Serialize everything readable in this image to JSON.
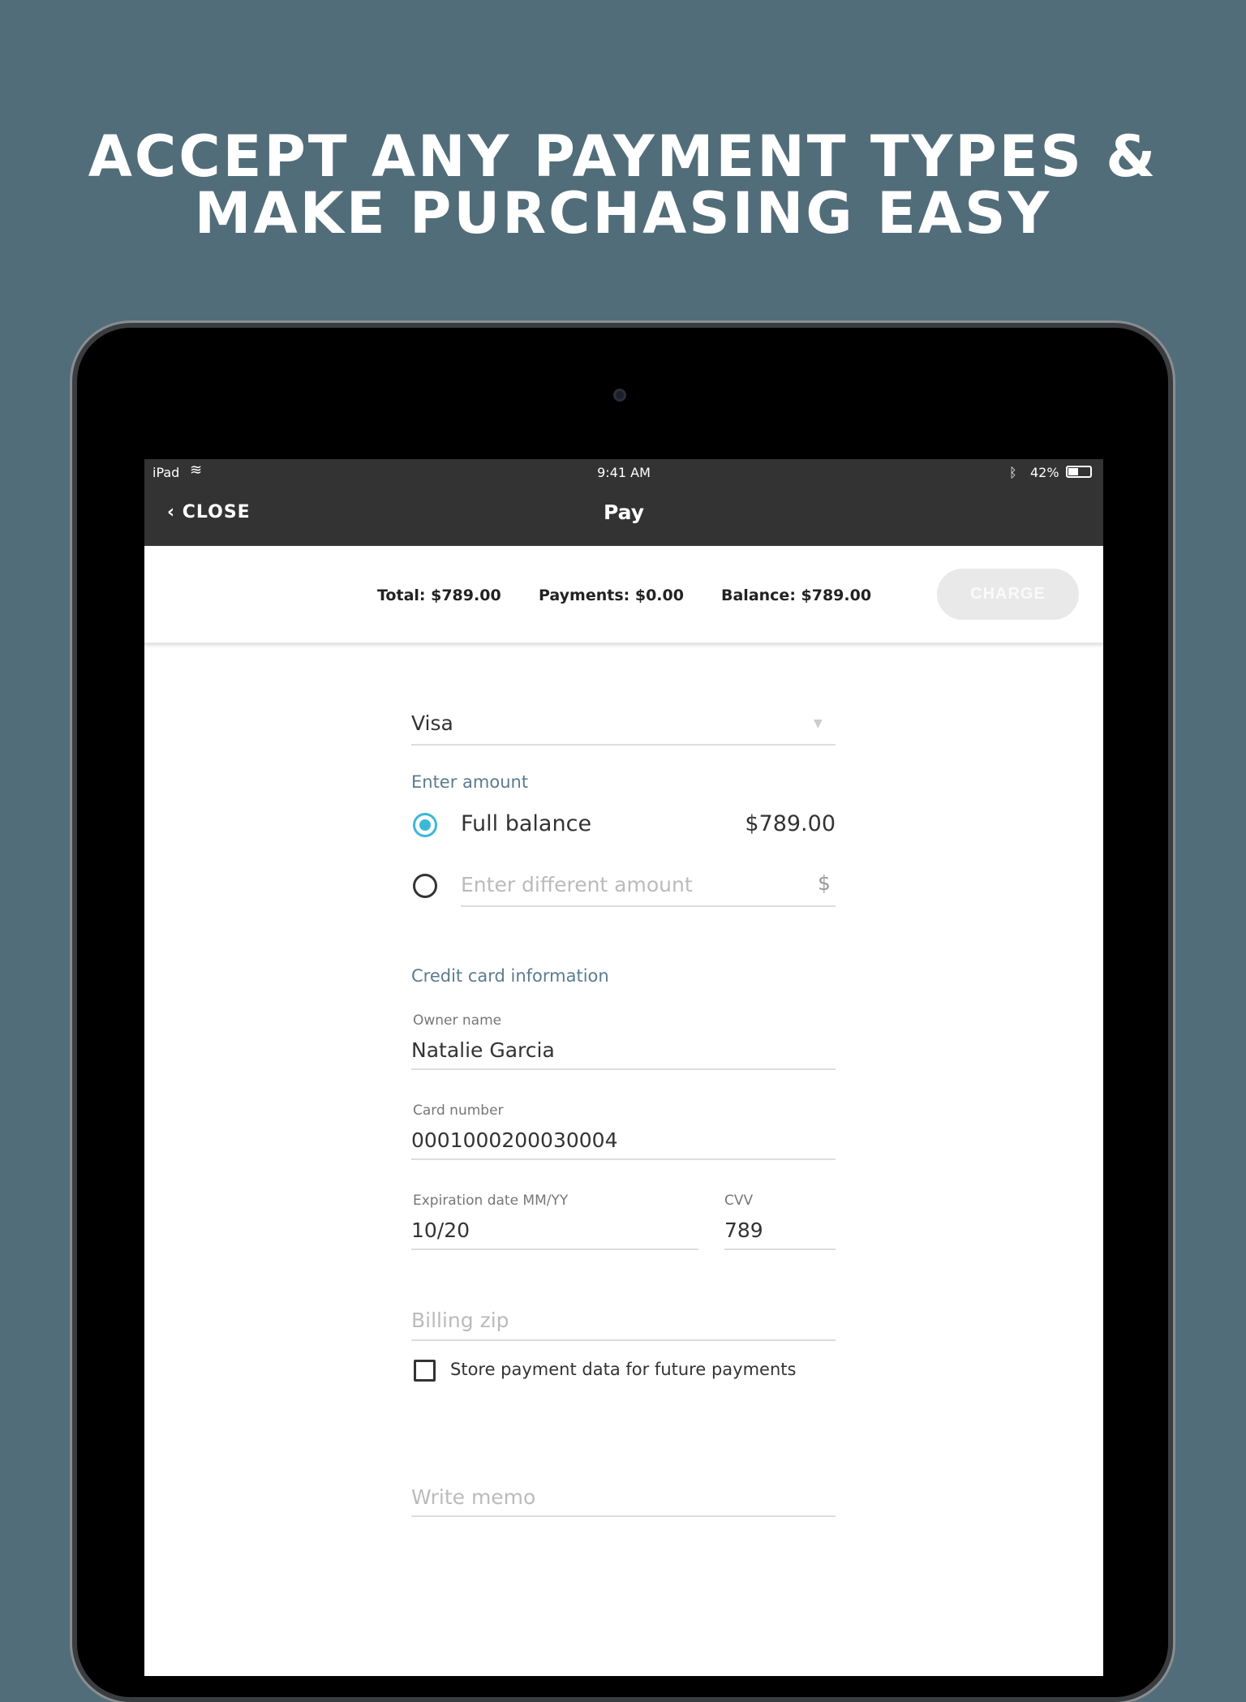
{
  "headline": {
    "line1": "ACCEPT ANY PAYMENT TYPES &",
    "line2": "MAKE PURCHASING EASY"
  },
  "status_bar": {
    "device": "iPad",
    "time": "9:41 AM",
    "battery": "42%",
    "battery_level": 0.42
  },
  "nav": {
    "close_label": "CLOSE",
    "title": "Pay"
  },
  "summary": {
    "total": "Total: $789.00",
    "payments": "Payments: $0.00",
    "balance": "Balance: $789.00",
    "charge_label": "CHARGE"
  },
  "form": {
    "payment_type": "Visa",
    "amount_section": "Enter amount",
    "full_balance_label": "Full balance",
    "full_balance_value": "$789.00",
    "different_amount_placeholder": "Enter different amount",
    "currency_symbol": "$",
    "card_section": "Credit card information",
    "owner_label": "Owner name",
    "owner_value": "Natalie Garcia",
    "card_label": "Card number",
    "card_value": "0001000200030004",
    "exp_label": "Expiration date MM/YY",
    "exp_value": "10/20",
    "cvv_label": "CVV",
    "cvv_value": "789",
    "zip_placeholder": "Billing zip",
    "store_label": "Store payment data for future payments",
    "memo_placeholder": "Write memo"
  },
  "colors": {
    "background": "#526d7a",
    "accent": "#3bb7d9",
    "navbar": "#333333"
  }
}
